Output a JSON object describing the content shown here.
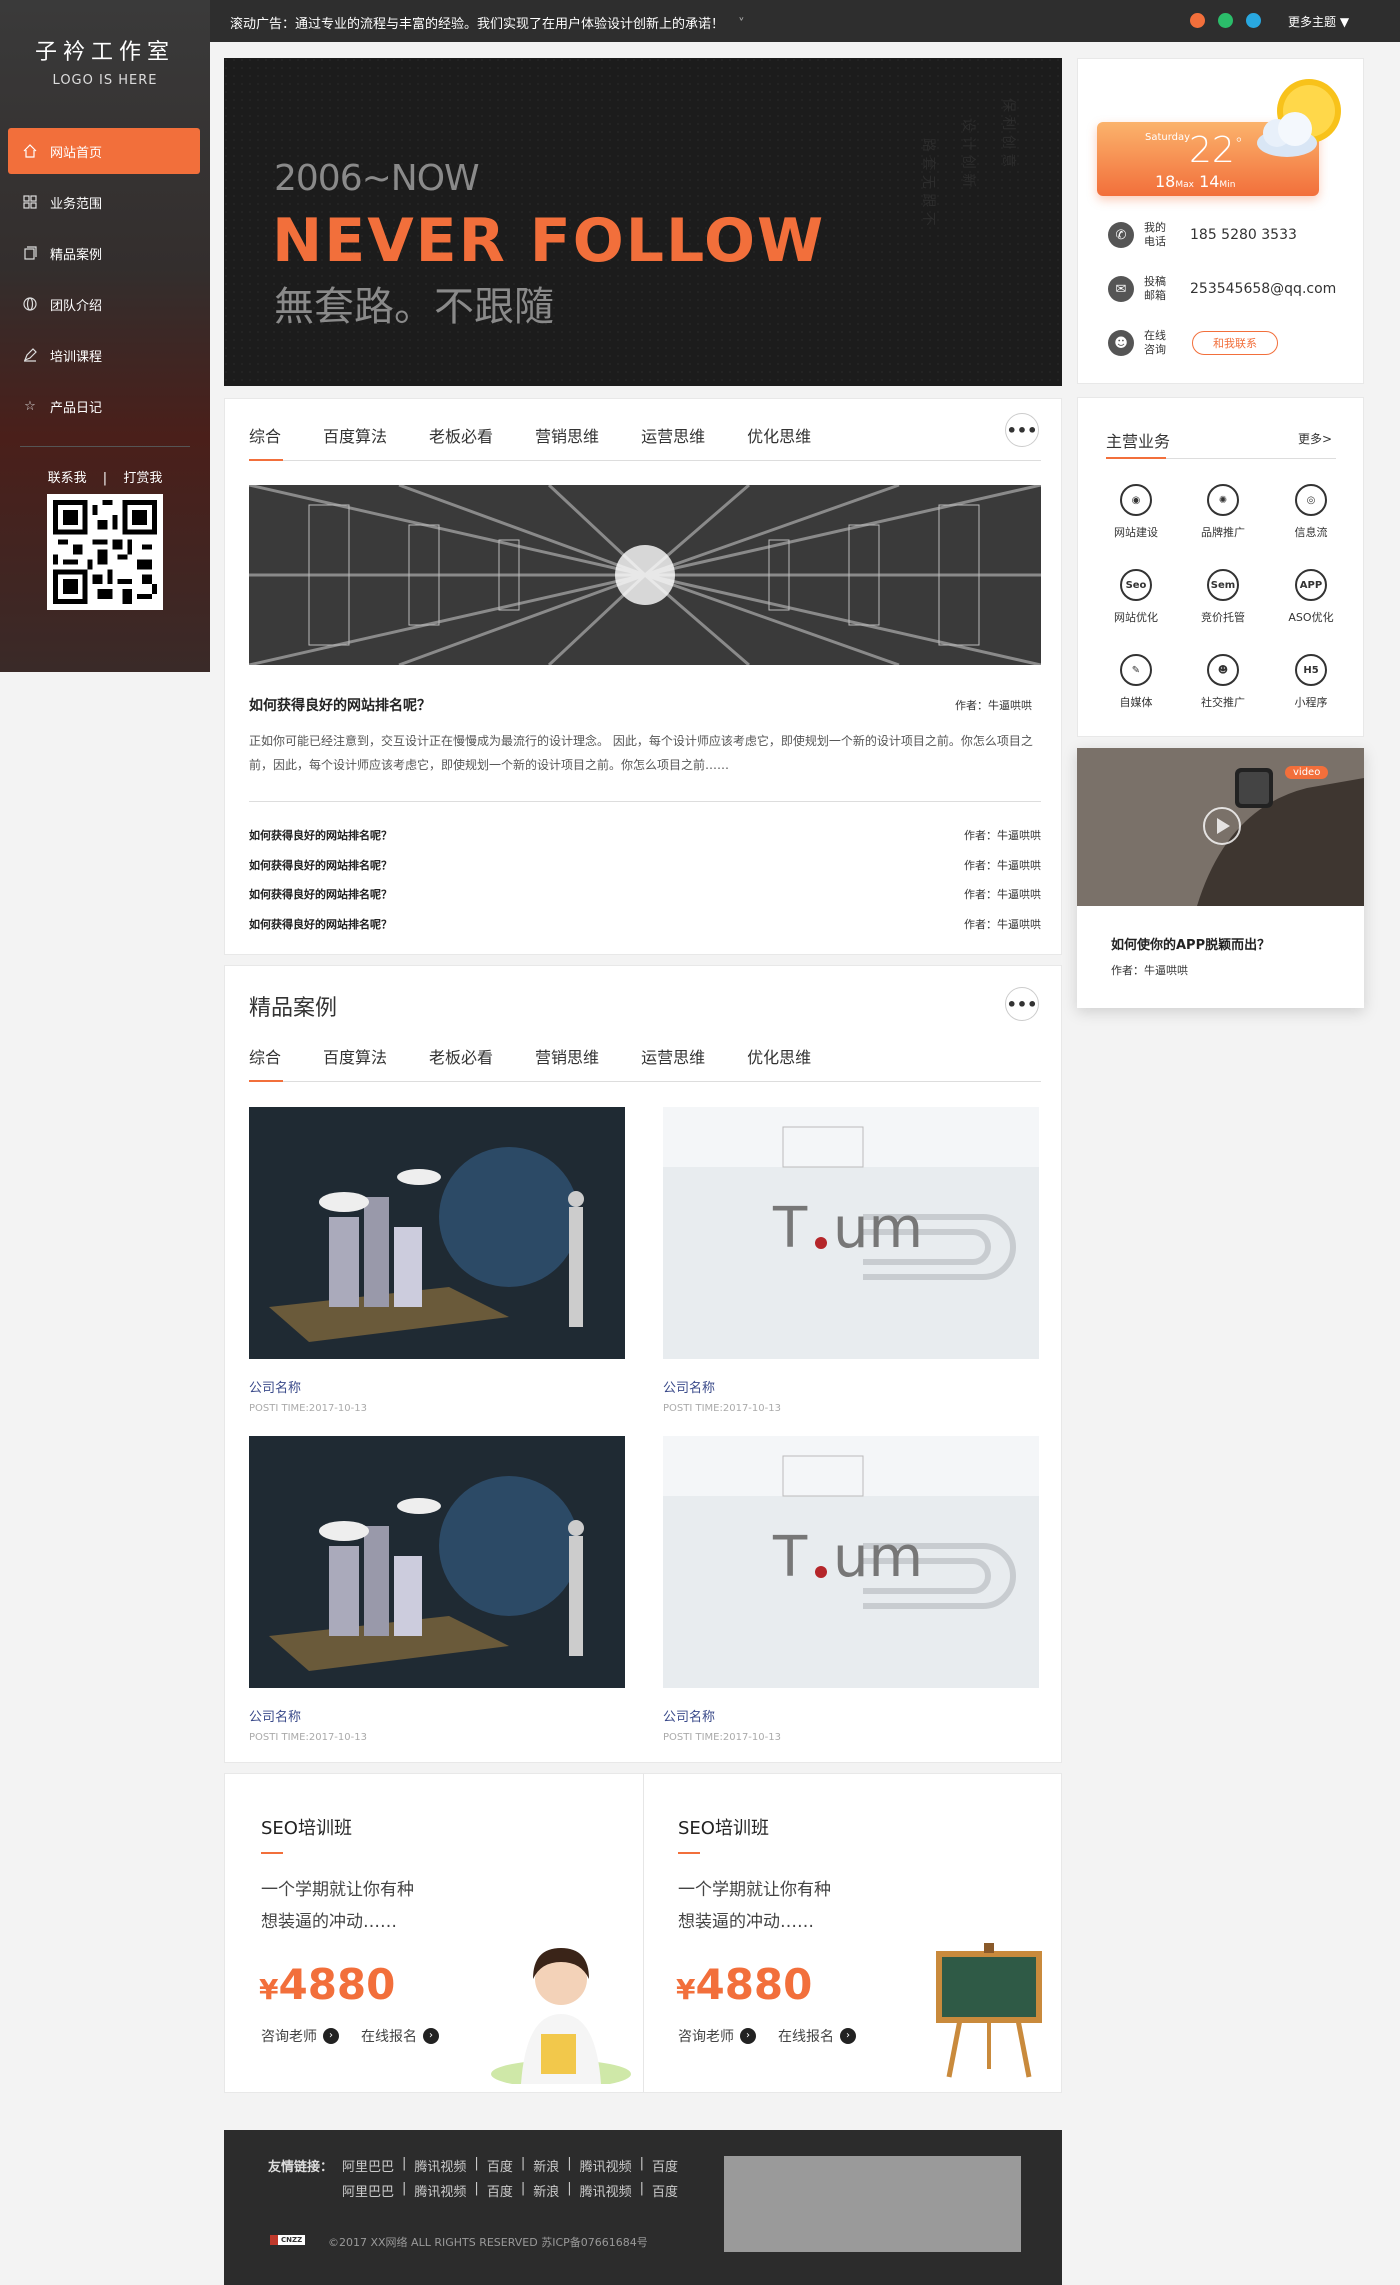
{
  "sidebar": {
    "title": "子衿工作室",
    "subtitle": "LOGO IS HERE",
    "items": [
      {
        "label": "网站首页",
        "icon": "home-icon"
      },
      {
        "label": "业务范围",
        "icon": "grid-icon"
      },
      {
        "label": "精品案例",
        "icon": "document-icon"
      },
      {
        "label": "团队介绍",
        "icon": "globe-icon"
      },
      {
        "label": "培训课程",
        "icon": "pen-icon"
      },
      {
        "label": "产品日记",
        "icon": "star-icon"
      }
    ],
    "contact": "联系我",
    "separator": "|",
    "reward": "打赏我"
  },
  "topbar": {
    "ticker": "滚动广告：通过专业的流程与丰富的经验。我们实现了在用户体验设计创新上的承诺！",
    "ticker_arrow": "˅",
    "dots": [
      "#f26f3b",
      "#2bbd6a",
      "#29a8e0"
    ],
    "more_theme": "更多主题 ▼"
  },
  "banner": {
    "line1": "2006~NOW",
    "line2": "NEVER FOLLOW",
    "line3": "無套路。不跟隨"
  },
  "tabs": [
    "综合",
    "百度算法",
    "老板必看",
    "营销思维",
    "运营思维",
    "优化思维"
  ],
  "more": "•••",
  "news": {
    "title": "如何获得良好的网站排名呢？",
    "author": "作者：牛逼哄哄",
    "excerpt": "正如你可能已经注意到，交互设计正在慢慢成为最流行的设计理念。 因此，每个设计师应该考虑它，即使规划一个新的设计项目之前。你怎么项目之前，因此，每个设计师应该考虑它，即使规划一个新的设计项目之前。你怎么项目之前……",
    "list": [
      {
        "title": "如何获得良好的网站排名呢？",
        "author": "作者：牛逼哄哄"
      },
      {
        "title": "如何获得良好的网站排名呢？",
        "author": "作者：牛逼哄哄"
      },
      {
        "title": "如何获得良好的网站排名呢？",
        "author": "作者：牛逼哄哄"
      },
      {
        "title": "如何获得良好的网站排名呢？",
        "author": "作者：牛逼哄哄"
      }
    ]
  },
  "cases": {
    "heading": "精品案例",
    "items": [
      {
        "name": "公司名称",
        "time": "POSTI TIME:2017-10-13"
      },
      {
        "name": "公司名称",
        "time": "POSTI TIME:2017-10-13"
      },
      {
        "name": "公司名称",
        "time": "POSTI TIME:2017-10-13"
      },
      {
        "name": "公司名称",
        "time": "POSTI TIME:2017-10-13"
      }
    ]
  },
  "training": [
    {
      "title": "SEO培训班",
      "desc1": "一个学期就让你有种",
      "desc2": "想装逼的冲动……",
      "currency": "¥",
      "price": "4880",
      "consult": "咨询老师",
      "signup": "在线报名"
    },
    {
      "title": "SEO培训班",
      "desc1": "一个学期就让你有种",
      "desc2": "想装逼的冲动……",
      "currency": "¥",
      "price": "4880",
      "consult": "咨询老师",
      "signup": "在线报名"
    }
  ],
  "weather": {
    "day": "Saturday",
    "temp": "22",
    "deg": "°",
    "max": "18",
    "max_label": "Max",
    "min": "14",
    "min_label": "Min"
  },
  "contact": [
    {
      "label": "我的电话",
      "value": "185 5280 3533",
      "icon": "phone-icon"
    },
    {
      "label": "投稿邮箱",
      "value": "253545658@qq.com",
      "icon": "mail-icon"
    },
    {
      "label": "在线咨询",
      "value": "和我联系",
      "icon": "chat-icon"
    }
  ],
  "services": {
    "heading": "主营业务",
    "more": "更多>",
    "items": [
      {
        "label": "网站建设",
        "glyph": "◉",
        "icon": "globe-icon"
      },
      {
        "label": "品牌推广",
        "glyph": "✺",
        "icon": "atom-icon"
      },
      {
        "label": "信息流",
        "glyph": "◎",
        "icon": "aperture-icon"
      },
      {
        "label": "网站优化",
        "glyph": "Seo",
        "icon": "seo-icon"
      },
      {
        "label": "竞价托管",
        "glyph": "Sem",
        "icon": "sem-icon"
      },
      {
        "label": "ASO优化",
        "glyph": "APP",
        "icon": "app-icon"
      },
      {
        "label": "自媒体",
        "glyph": "✎",
        "icon": "pen-icon"
      },
      {
        "label": "社交推广",
        "glyph": "☻",
        "icon": "qq-icon"
      },
      {
        "label": "小程序",
        "glyph": "H5",
        "icon": "h5-icon"
      }
    ]
  },
  "video": {
    "badge": "video",
    "title": "如何使你的APP脱颖而出？",
    "author": "作者：牛逼哄哄"
  },
  "footer": {
    "label": "友情链接：",
    "links_row1": [
      "阿里巴巴",
      "腾讯视频",
      "百度",
      "新浪",
      "腾讯视频",
      "百度"
    ],
    "links_row2": [
      "阿里巴巴",
      "腾讯视频",
      "百度",
      "新浪",
      "腾讯视频",
      "百度"
    ],
    "badge": "CNZZ",
    "copyright": "©2017 XX网络 ALL RIGHTS RESERVED 苏ICP备07661684号"
  }
}
